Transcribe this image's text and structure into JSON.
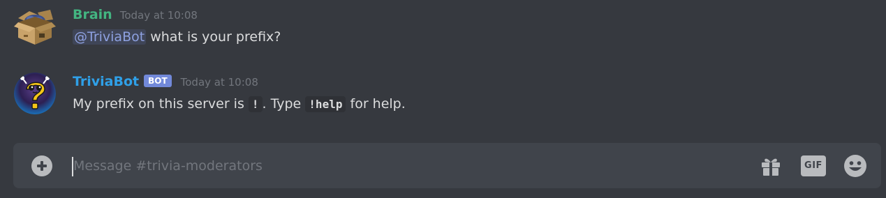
{
  "messages": [
    {
      "author": "Brain",
      "author_color": "#43b581",
      "timestamp": "Today at 10:08",
      "avatar_icon": "cardboard-box-brain-icon",
      "mention": "@TriviaBot",
      "text": " what is your prefix?"
    },
    {
      "author": "TriviaBot",
      "author_color": "#2fa0e8",
      "bot_tag": "BOT",
      "timestamp": "Today at 10:08",
      "avatar_icon": "trivia-question-mark-icon",
      "text_1": "My prefix on this server is ",
      "code_1": "!",
      "text_2": ". Type ",
      "code_2": "!help",
      "text_3": " for help."
    }
  ],
  "composer": {
    "placeholder": "Message #trivia-moderators",
    "gif_label": "GIF",
    "attach_icon": "plus-circle-icon",
    "gift_icon": "gift-icon",
    "emoji_icon": "smiley-icon"
  }
}
